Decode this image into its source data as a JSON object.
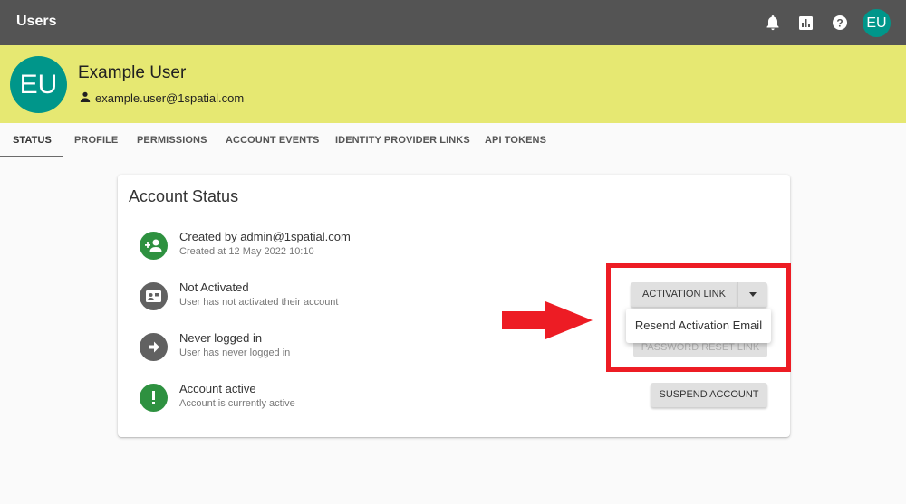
{
  "topbar": {
    "title": "Users",
    "icons": [
      "bell-icon",
      "chart-icon",
      "help-icon"
    ],
    "avatar_initials": "EU"
  },
  "user": {
    "initials": "EU",
    "name": "Example User",
    "email": "example.user@1spatial.com"
  },
  "tabs": [
    {
      "label": "STATUS",
      "active": true
    },
    {
      "label": "PROFILE"
    },
    {
      "label": "PERMISSIONS"
    },
    {
      "label": "ACCOUNT EVENTS"
    },
    {
      "label": "IDENTITY PROVIDER LINKS"
    },
    {
      "label": "API TOKENS"
    }
  ],
  "card": {
    "title": "Account Status",
    "rows": [
      {
        "icon": "person-add-icon",
        "title": "Created by admin@1spatial.com",
        "subtitle": "Created at 12 May 2022 10:10"
      },
      {
        "icon": "id-card-icon",
        "title": "Not Activated",
        "subtitle": "User has not activated their account"
      },
      {
        "icon": "arrow-right-icon",
        "title": "Never logged in",
        "subtitle": "User has never logged in"
      },
      {
        "icon": "exclamation-icon",
        "title": "Account active",
        "subtitle": "Account is currently active"
      }
    ],
    "buttons": {
      "activation_link": "ACTIVATION LINK",
      "password_reset_link": "PASSWORD RESET LINK",
      "suspend_account": "SUSPEND ACCOUNT"
    },
    "dropdown_menu": {
      "items": [
        "Resend Activation Email"
      ]
    }
  },
  "annotation": {
    "color": "#ed1c24"
  }
}
